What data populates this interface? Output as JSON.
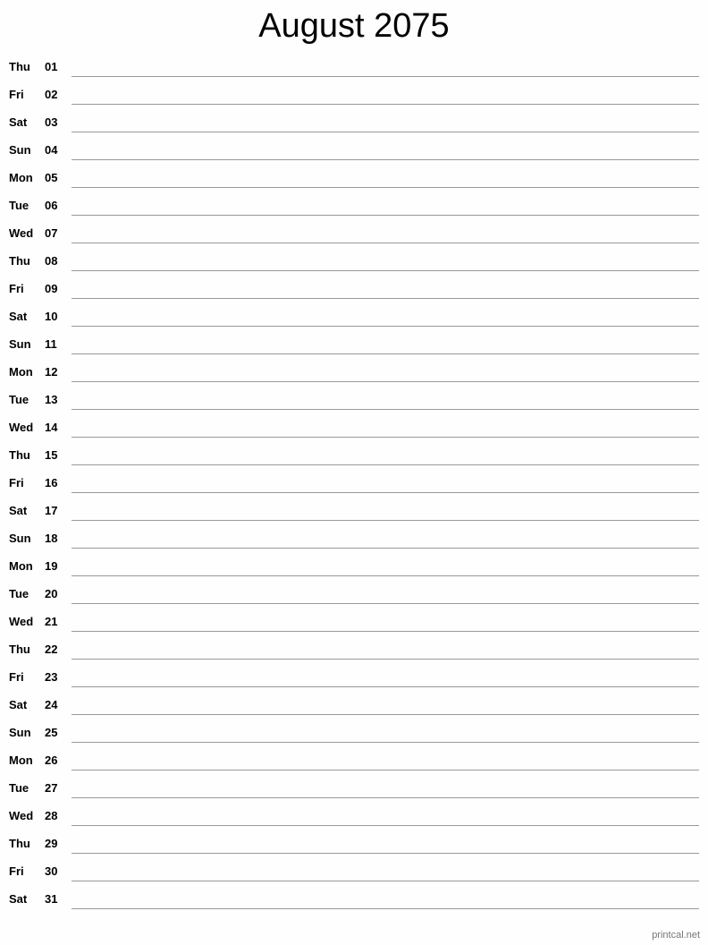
{
  "title": "August 2075",
  "days": [
    {
      "dow": "Thu",
      "day": "01"
    },
    {
      "dow": "Fri",
      "day": "02"
    },
    {
      "dow": "Sat",
      "day": "03"
    },
    {
      "dow": "Sun",
      "day": "04"
    },
    {
      "dow": "Mon",
      "day": "05"
    },
    {
      "dow": "Tue",
      "day": "06"
    },
    {
      "dow": "Wed",
      "day": "07"
    },
    {
      "dow": "Thu",
      "day": "08"
    },
    {
      "dow": "Fri",
      "day": "09"
    },
    {
      "dow": "Sat",
      "day": "10"
    },
    {
      "dow": "Sun",
      "day": "11"
    },
    {
      "dow": "Mon",
      "day": "12"
    },
    {
      "dow": "Tue",
      "day": "13"
    },
    {
      "dow": "Wed",
      "day": "14"
    },
    {
      "dow": "Thu",
      "day": "15"
    },
    {
      "dow": "Fri",
      "day": "16"
    },
    {
      "dow": "Sat",
      "day": "17"
    },
    {
      "dow": "Sun",
      "day": "18"
    },
    {
      "dow": "Mon",
      "day": "19"
    },
    {
      "dow": "Tue",
      "day": "20"
    },
    {
      "dow": "Wed",
      "day": "21"
    },
    {
      "dow": "Thu",
      "day": "22"
    },
    {
      "dow": "Fri",
      "day": "23"
    },
    {
      "dow": "Sat",
      "day": "24"
    },
    {
      "dow": "Sun",
      "day": "25"
    },
    {
      "dow": "Mon",
      "day": "26"
    },
    {
      "dow": "Tue",
      "day": "27"
    },
    {
      "dow": "Wed",
      "day": "28"
    },
    {
      "dow": "Thu",
      "day": "29"
    },
    {
      "dow": "Fri",
      "day": "30"
    },
    {
      "dow": "Sat",
      "day": "31"
    }
  ],
  "footer": "printcal.net"
}
